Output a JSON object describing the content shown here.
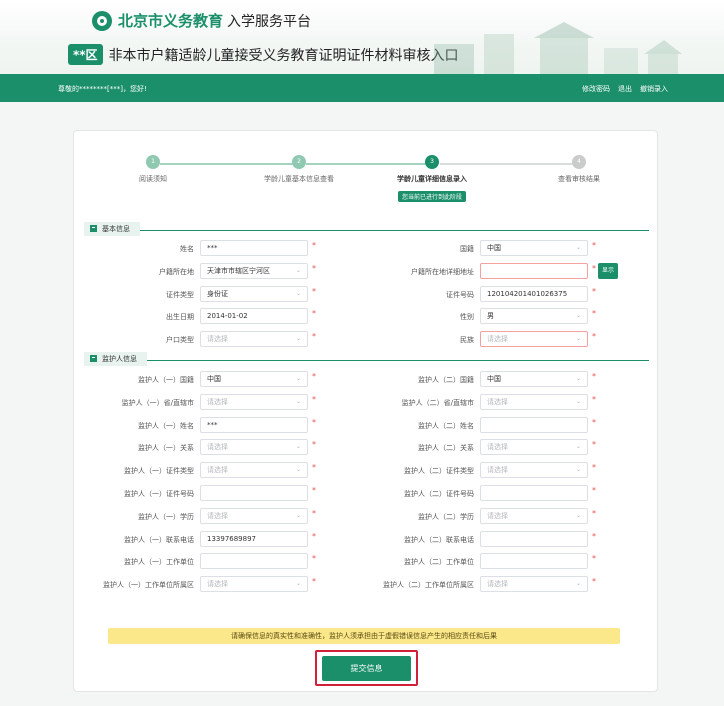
{
  "header": {
    "brand_bold": "北京市义务教育",
    "brand_normal": "入学服务平台",
    "district_badge": "**区",
    "subtitle": "非本市户籍适龄儿童接受义务教育证明证件材料审核入口"
  },
  "topbar": {
    "greeting": "尊敬的********[***]，您好!",
    "links": [
      "修改密码",
      "退出",
      "撤销录入"
    ]
  },
  "steps": [
    {
      "num": "1",
      "label": "阅读须知",
      "state": "done"
    },
    {
      "num": "2",
      "label": "学龄儿童基本信息查看",
      "state": "done"
    },
    {
      "num": "3",
      "label": "学龄儿童详细信息录入",
      "state": "active",
      "note": "您当前已进行到此阶段"
    },
    {
      "num": "4",
      "label": "查看审核结果",
      "state": "pending"
    }
  ],
  "sections": {
    "basic": "基本信息",
    "guardian": "监护人信息"
  },
  "basic_left": [
    {
      "label": "姓名",
      "value": "***",
      "type": "input",
      "placeholder": false
    },
    {
      "label": "户籍所在地",
      "value": "天津市市辖区宁河区",
      "type": "select",
      "placeholder": false
    },
    {
      "label": "证件类型",
      "value": "身份证",
      "type": "select",
      "placeholder": false
    },
    {
      "label": "出生日期",
      "value": "2014-01-02",
      "type": "input",
      "placeholder": false
    },
    {
      "label": "户口类型",
      "value": "请选择",
      "type": "select",
      "placeholder": true
    }
  ],
  "basic_right": [
    {
      "label": "国籍",
      "value": "中国",
      "type": "select",
      "placeholder": false
    },
    {
      "label": "户籍所在地详细地址",
      "value": "",
      "type": "input",
      "placeholder": false,
      "error": true,
      "button": "显示"
    },
    {
      "label": "证件号码",
      "value": "120104201401026375",
      "type": "input",
      "placeholder": false
    },
    {
      "label": "性别",
      "value": "男",
      "type": "select",
      "placeholder": false
    },
    {
      "label": "民族",
      "value": "请选择",
      "type": "select",
      "placeholder": true,
      "error": true
    }
  ],
  "guardian_left": [
    {
      "label": "监护人（一）国籍",
      "value": "中国",
      "type": "select",
      "placeholder": false
    },
    {
      "label": "监护人（一）省/直辖市",
      "value": "请选择",
      "type": "select",
      "placeholder": true
    },
    {
      "label": "监护人（一）姓名",
      "value": "***",
      "type": "input",
      "placeholder": false
    },
    {
      "label": "监护人（一）关系",
      "value": "请选择",
      "type": "select",
      "placeholder": true
    },
    {
      "label": "监护人（一）证件类型",
      "value": "请选择",
      "type": "select",
      "placeholder": true
    },
    {
      "label": "监护人（一）证件号码",
      "value": "",
      "type": "input",
      "placeholder": false
    },
    {
      "label": "监护人（一）学历",
      "value": "请选择",
      "type": "select",
      "placeholder": true
    },
    {
      "label": "监护人（一）联系电话",
      "value": "13397689897",
      "type": "input",
      "placeholder": false
    },
    {
      "label": "监护人（一）工作单位",
      "value": "",
      "type": "input",
      "placeholder": false
    },
    {
      "label": "监护人（一）工作单位所属区",
      "value": "请选择",
      "type": "select",
      "placeholder": true
    }
  ],
  "guardian_right": [
    {
      "label": "监护人（二）国籍",
      "value": "中国",
      "type": "select",
      "placeholder": false
    },
    {
      "label": "监护人（二）省/直辖市",
      "value": "请选择",
      "type": "select",
      "placeholder": true
    },
    {
      "label": "监护人（二）姓名",
      "value": "",
      "type": "input",
      "placeholder": false
    },
    {
      "label": "监护人（二）关系",
      "value": "请选择",
      "type": "select",
      "placeholder": true
    },
    {
      "label": "监护人（二）证件类型",
      "value": "请选择",
      "type": "select",
      "placeholder": true
    },
    {
      "label": "监护人（二）证件号码",
      "value": "",
      "type": "input",
      "placeholder": false
    },
    {
      "label": "监护人（二）学历",
      "value": "请选择",
      "type": "select",
      "placeholder": true
    },
    {
      "label": "监护人（二）联系电话",
      "value": "",
      "type": "input",
      "placeholder": false
    },
    {
      "label": "监护人（二）工作单位",
      "value": "",
      "type": "input",
      "placeholder": false
    },
    {
      "label": "监护人（二）工作单位所属区",
      "value": "请选择",
      "type": "select",
      "placeholder": true
    }
  ],
  "notice": "请确保信息的真实性和准确性，监护人须承担由于虚假错误信息产生的相应责任和后果",
  "submit_label": "提交信息",
  "colors": {
    "primary": "#1a8f6a",
    "required": "#e25555",
    "notice_bg": "#fbe88a",
    "highlight": "#d0203a"
  }
}
